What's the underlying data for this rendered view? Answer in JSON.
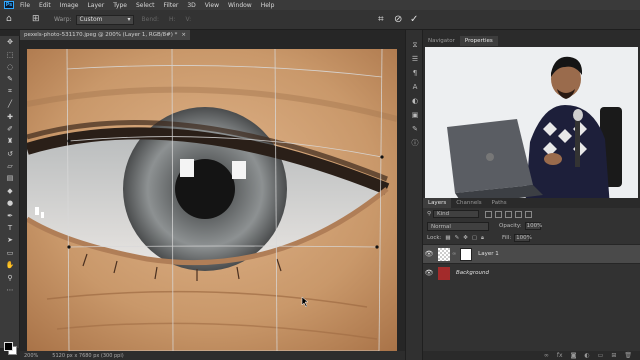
{
  "app": {
    "logo": "Ps"
  },
  "menu": [
    "File",
    "Edit",
    "Image",
    "Layer",
    "Type",
    "Select",
    "Filter",
    "3D",
    "View",
    "Window",
    "Help"
  ],
  "options": {
    "home_icon": "home-icon",
    "tool_icon": "warp-tool-icon",
    "warp_label": "Warp:",
    "warp_value": "Custom",
    "dimmed_fields": [
      "Bend:",
      "H:",
      "V:"
    ],
    "right_icons": [
      "warp-toggle-icon",
      "cancel-icon",
      "commit-check-icon"
    ]
  },
  "document": {
    "tab_title": "pexels-photo-531170.jpeg @ 200% (Layer 1, RGB/8#) *",
    "close": "×",
    "zoom": "200%",
    "doc_info": "5120 px x 7680 px (300 ppi)"
  },
  "tools": [
    "move-icon",
    "marquee-icon",
    "lasso-icon",
    "quick-select-icon",
    "crop-icon",
    "eyedropper-icon",
    "healing-icon",
    "brush-icon",
    "clone-stamp-icon",
    "history-brush-icon",
    "eraser-icon",
    "gradient-icon",
    "blur-icon",
    "dodge-icon",
    "pen-icon",
    "type-icon",
    "path-select-icon",
    "rectangle-icon",
    "hand-icon",
    "zoom-icon",
    "more-icon"
  ],
  "mid_strip_icons": [
    "history-icon",
    "properties-icon",
    "paragraph-icon",
    "character-icon",
    "adjustments-icon",
    "styles-icon",
    "brushes-icon",
    "info-icon"
  ],
  "top_panel": {
    "tabs": [
      "Navigator",
      "Properties"
    ],
    "active_tab": 1
  },
  "layers_panel": {
    "tabs": [
      "Layers",
      "Channels",
      "Paths"
    ],
    "active_tab": 0,
    "kind_label": "Kind",
    "blend_mode": "Normal",
    "opacity_label": "Opacity:",
    "opacity_value": "100%",
    "lock_label": "Lock:",
    "fill_label": "Fill:",
    "fill_value": "100%",
    "layers": [
      {
        "name": "Layer 1",
        "selected": true,
        "italic": false
      },
      {
        "name": "Background",
        "selected": false,
        "italic": true
      }
    ],
    "footer_icons": [
      "link-icon",
      "fx-icon",
      "mask-icon",
      "adjustment-icon",
      "group-icon",
      "new-layer-icon",
      "trash-icon"
    ]
  }
}
